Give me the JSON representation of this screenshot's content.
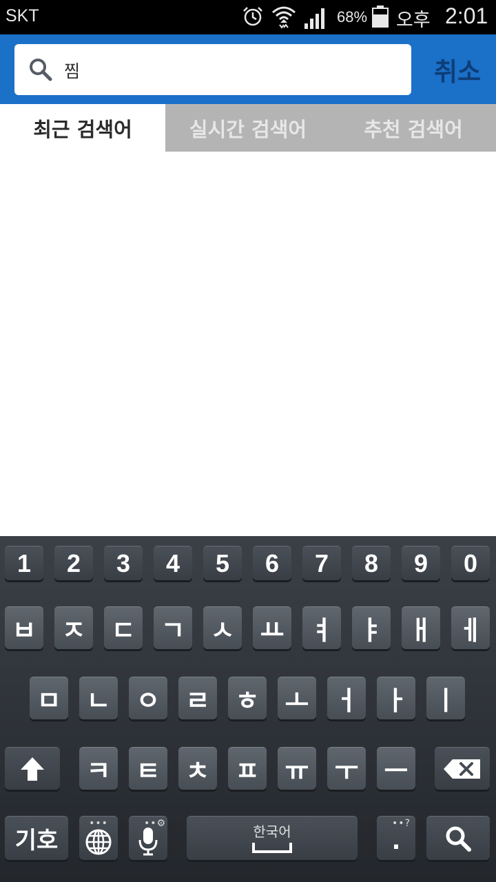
{
  "status_bar": {
    "carrier": "SKT",
    "battery_percent": "68%",
    "ampm": "오후",
    "time": "2:01",
    "icons": [
      "alarm-icon",
      "wifi-icon",
      "signal-icon",
      "battery-icon"
    ]
  },
  "search": {
    "query": "찜",
    "cancel_label": "취소"
  },
  "tabs": [
    {
      "label": "최근 검색어",
      "active": true
    },
    {
      "label": "실시간 검색어",
      "active": false
    },
    {
      "label": "추천 검색어",
      "active": false
    }
  ],
  "keyboard": {
    "row_numbers": [
      "1",
      "2",
      "3",
      "4",
      "5",
      "6",
      "7",
      "8",
      "9",
      "0"
    ],
    "row1": [
      "ㅂ",
      "ㅈ",
      "ㄷ",
      "ㄱ",
      "ㅅ",
      "ㅛ",
      "ㅕ",
      "ㅑ",
      "ㅐ",
      "ㅔ"
    ],
    "row2": [
      "ㅁ",
      "ㄴ",
      "ㅇ",
      "ㄹ",
      "ㅎ",
      "ㅗ",
      "ㅓ",
      "ㅏ",
      "ㅣ"
    ],
    "row3": [
      "ㅋ",
      "ㅌ",
      "ㅊ",
      "ㅍ",
      "ㅠ",
      "ㅜ",
      "ㅡ"
    ],
    "symbols_label": "기호",
    "space_label": "한국어",
    "period_label": ".",
    "period_hint": "?"
  },
  "colors": {
    "header_blue": "#1b70c8",
    "cancel_text": "#0d3e78",
    "tab_inactive_bg": "#b4b4b4"
  }
}
